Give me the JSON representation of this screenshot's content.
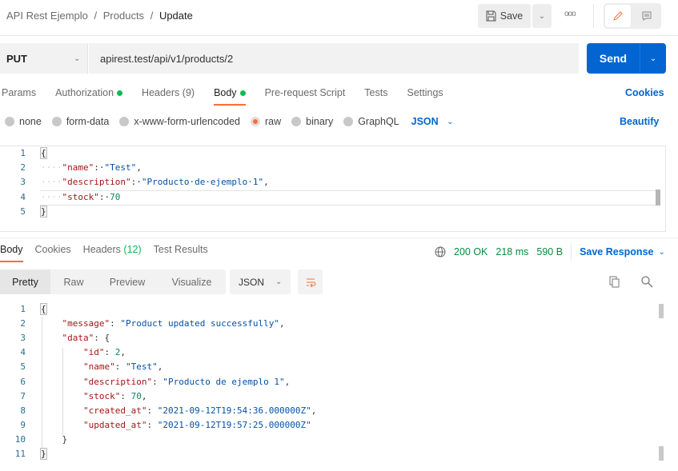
{
  "header": {
    "breadcrumb": [
      "API Rest Ejemplo",
      "Products",
      "Update"
    ],
    "separator": "/",
    "save_label": "Save"
  },
  "request": {
    "method": "PUT",
    "url": "apirest.test/api/v1/products/2",
    "send_label": "Send"
  },
  "tabs": [
    {
      "label": "Params"
    },
    {
      "label": "Authorization",
      "dot": true
    },
    {
      "label": "Headers",
      "count": "(9)"
    },
    {
      "label": "Body",
      "dot": true,
      "active": true
    },
    {
      "label": "Pre-request Script"
    },
    {
      "label": "Tests"
    },
    {
      "label": "Settings"
    }
  ],
  "cookies_label": "Cookies",
  "body_options": {
    "options": [
      "none",
      "form-data",
      "x-www-form-urlencoded",
      "raw",
      "binary",
      "GraphQL"
    ],
    "selected": "raw",
    "format": "JSON",
    "beautify_label": "Beautify"
  },
  "request_body": [
    [
      [
        "{",
        "brace"
      ]
    ],
    [
      [
        "····",
        "ws"
      ],
      [
        "\"name\"",
        "k"
      ],
      [
        ":·",
        "p"
      ],
      [
        "\"Test\"",
        "s"
      ],
      [
        ",",
        "p"
      ]
    ],
    [
      [
        "····",
        "ws"
      ],
      [
        "\"description\"",
        "k"
      ],
      [
        ":·",
        "p"
      ],
      [
        "\"Producto·de·ejemplo·1\"",
        "s"
      ],
      [
        ",",
        "p"
      ]
    ],
    [
      [
        "····",
        "ws"
      ],
      [
        "\"stock\"",
        "k"
      ],
      [
        ":·",
        "p"
      ],
      [
        "70",
        "n"
      ]
    ],
    [
      [
        "}",
        "brace"
      ]
    ]
  ],
  "response": {
    "tabs": [
      {
        "label": "Body",
        "active": true
      },
      {
        "label": "Cookies"
      },
      {
        "label": "Headers",
        "count": "(12)"
      },
      {
        "label": "Test Results"
      }
    ],
    "status": "200 OK",
    "time": "218 ms",
    "size": "590 B",
    "save_label": "Save Response",
    "views": [
      "Pretty",
      "Raw",
      "Preview",
      "Visualize"
    ],
    "active_view": "Pretty",
    "format": "JSON",
    "body": [
      [
        [
          "{",
          "brace"
        ]
      ],
      [
        [
          "    ",
          "p"
        ],
        [
          "\"message\"",
          "k"
        ],
        [
          ": ",
          "p"
        ],
        [
          "\"Product updated successfully\"",
          "s"
        ],
        [
          ",",
          "p"
        ]
      ],
      [
        [
          "    ",
          "p"
        ],
        [
          "\"data\"",
          "k"
        ],
        [
          ": {",
          "p"
        ]
      ],
      [
        [
          "        ",
          "p"
        ],
        [
          "\"id\"",
          "k"
        ],
        [
          ": ",
          "p"
        ],
        [
          "2",
          "n"
        ],
        [
          ",",
          "p"
        ]
      ],
      [
        [
          "        ",
          "p"
        ],
        [
          "\"name\"",
          "k"
        ],
        [
          ": ",
          "p"
        ],
        [
          "\"Test\"",
          "s"
        ],
        [
          ",",
          "p"
        ]
      ],
      [
        [
          "        ",
          "p"
        ],
        [
          "\"description\"",
          "k"
        ],
        [
          ": ",
          "p"
        ],
        [
          "\"Producto de ejemplo 1\"",
          "s"
        ],
        [
          ",",
          "p"
        ]
      ],
      [
        [
          "        ",
          "p"
        ],
        [
          "\"stock\"",
          "k"
        ],
        [
          ": ",
          "p"
        ],
        [
          "70",
          "n"
        ],
        [
          ",",
          "p"
        ]
      ],
      [
        [
          "        ",
          "p"
        ],
        [
          "\"created_at\"",
          "k"
        ],
        [
          ": ",
          "p"
        ],
        [
          "\"2021-09-12T19:54:36.000000Z\"",
          "s"
        ],
        [
          ",",
          "p"
        ]
      ],
      [
        [
          "        ",
          "p"
        ],
        [
          "\"updated_at\"",
          "k"
        ],
        [
          ": ",
          "p"
        ],
        [
          "\"2021-09-12T19:57:25.000000Z\"",
          "s"
        ]
      ],
      [
        [
          "    }",
          "p"
        ]
      ],
      [
        [
          "}",
          "brace"
        ]
      ]
    ]
  }
}
